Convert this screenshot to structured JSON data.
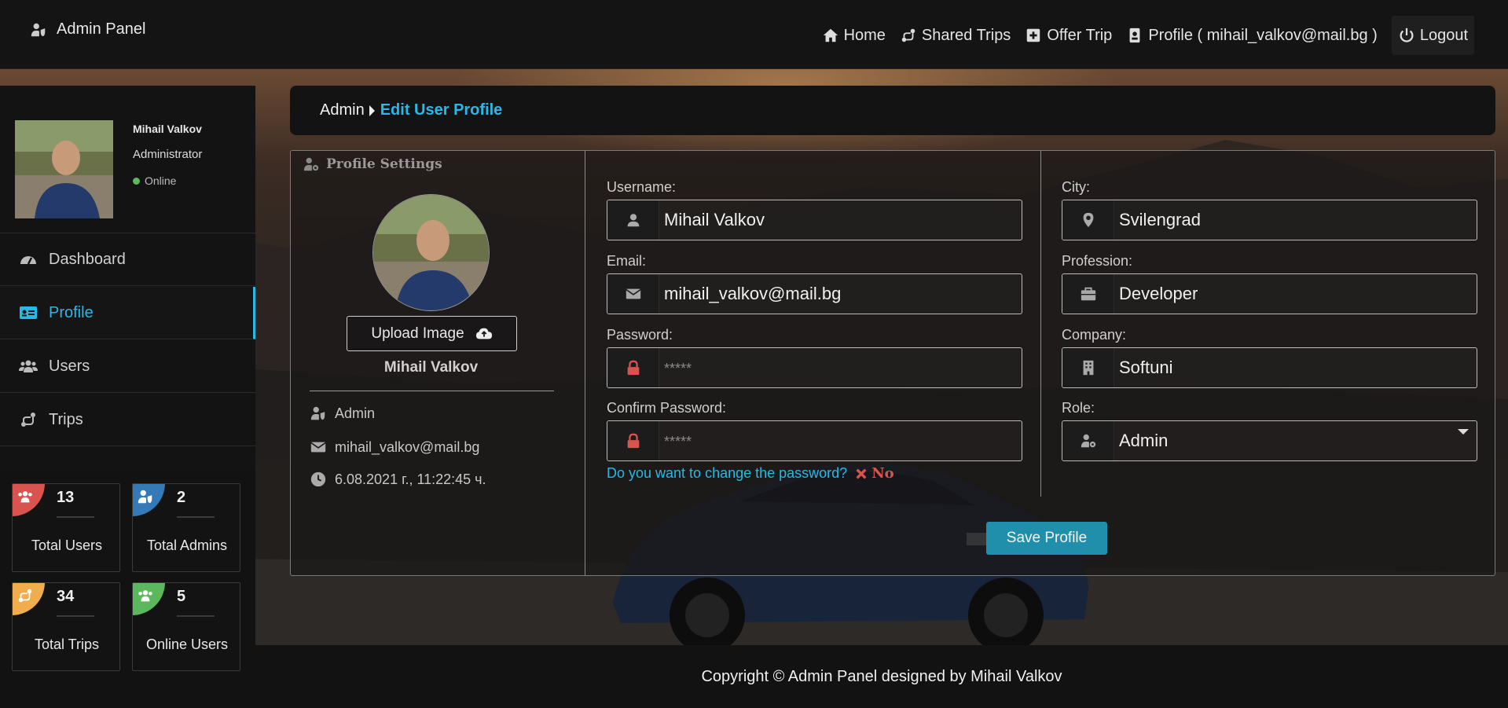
{
  "app": {
    "title": "Admin Panel"
  },
  "nav": {
    "home": "Home",
    "shared_trips": "Shared Trips",
    "offer_trip": "Offer Trip",
    "profile": "Profile ( mihail_valkov@mail.bg )",
    "logout": "Logout"
  },
  "sidebar": {
    "user": {
      "name": "Mihail Valkov",
      "role": "Administrator",
      "status": "Online"
    },
    "items": [
      {
        "label": "Dashboard",
        "icon": "dashboard-icon"
      },
      {
        "label": "Profile",
        "icon": "id-card-icon",
        "active": true
      },
      {
        "label": "Users",
        "icon": "users-icon"
      },
      {
        "label": "Trips",
        "icon": "route-icon"
      }
    ]
  },
  "stats": [
    {
      "value": "13",
      "label": "Total Users",
      "color": "#d9534f",
      "icon": "users-icon"
    },
    {
      "value": "2",
      "label": "Total Admins",
      "color": "#337ab7",
      "icon": "user-shield-icon"
    },
    {
      "value": "34",
      "label": "Total Trips",
      "color": "#f0ad4e",
      "icon": "route-icon"
    },
    {
      "value": "5",
      "label": "Online Users",
      "color": "#5cb85c",
      "icon": "users-icon"
    }
  ],
  "breadcrumb": {
    "root": "Admin",
    "current": "Edit User Profile"
  },
  "profile_settings": {
    "title": "Profile Settings",
    "upload_label": "Upload Image",
    "name": "Mihail Valkov",
    "role": "Admin",
    "email": "mihail_valkov@mail.bg",
    "created": "6.08.2021 г., 11:22:45 ч."
  },
  "form": {
    "username": {
      "label": "Username:",
      "value": "Mihail Valkov"
    },
    "email": {
      "label": "Email:",
      "value": "mihail_valkov@mail.bg"
    },
    "password": {
      "label": "Password:",
      "placeholder": "*****"
    },
    "confirm_password": {
      "label": "Confirm Password:",
      "placeholder": "*****"
    },
    "change_password_question": "Do you want to change the password?",
    "change_password_answer": "No",
    "city": {
      "label": "City:",
      "value": "Svilengrad"
    },
    "profession": {
      "label": "Profession:",
      "value": "Developer"
    },
    "company": {
      "label": "Company:",
      "value": "Softuni"
    },
    "role": {
      "label": "Role:",
      "value": "Admin"
    },
    "save_label": "Save Profile"
  },
  "footer": {
    "text": "Copyright © Admin Panel designed by Mihail Valkov"
  },
  "colors": {
    "accent": "#27b9e8",
    "danger": "#d9534f",
    "save": "#1f8fab"
  }
}
